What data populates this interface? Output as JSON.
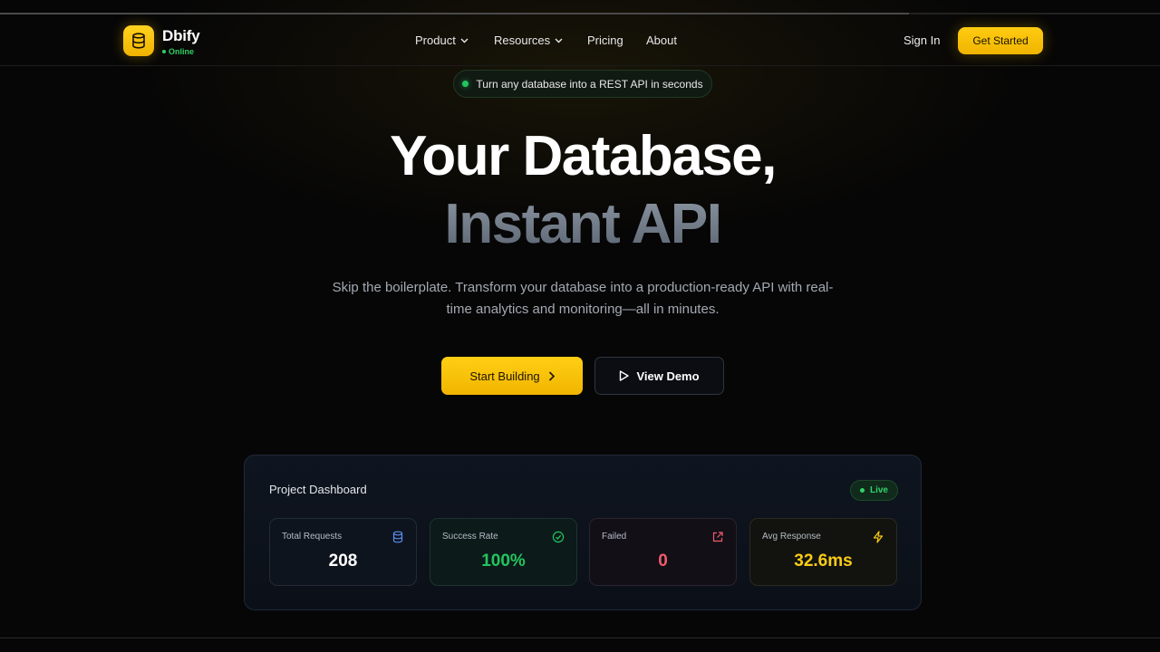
{
  "brand": {
    "name": "Dbify",
    "status": "Online",
    "logo_icon": "database-icon"
  },
  "nav": {
    "items": [
      {
        "label": "Product",
        "has_dropdown": true
      },
      {
        "label": "Resources",
        "has_dropdown": true
      },
      {
        "label": "Pricing",
        "has_dropdown": false
      },
      {
        "label": "About",
        "has_dropdown": false
      }
    ],
    "sign_in": "Sign In",
    "get_started": "Get Started"
  },
  "announcement": {
    "text": "Turn any database into a REST API in seconds"
  },
  "hero": {
    "title_line1": "Your Database,",
    "title_line2": "Instant API",
    "subtitle": "Skip the boilerplate. Transform your database into a production-ready API with real-time analytics and monitoring—all in minutes.",
    "primary_cta": "Start Building",
    "secondary_cta": "View Demo"
  },
  "dashboard": {
    "title": "Project Dashboard",
    "live_label": "Live",
    "stats": [
      {
        "label": "Total Requests",
        "value": "208",
        "icon": "database-icon",
        "color": "#ffffff"
      },
      {
        "label": "Success Rate",
        "value": "100%",
        "icon": "check-circle-icon",
        "color": "#22c55e"
      },
      {
        "label": "Failed",
        "value": "0",
        "icon": "external-link-icon",
        "color": "#f05b6b"
      },
      {
        "label": "Avg Response",
        "value": "32.6ms",
        "icon": "lightning-icon",
        "color": "#facc15"
      }
    ]
  },
  "colors": {
    "accent": "#fbbf0a",
    "background": "#060606",
    "online": "#22c55e"
  }
}
